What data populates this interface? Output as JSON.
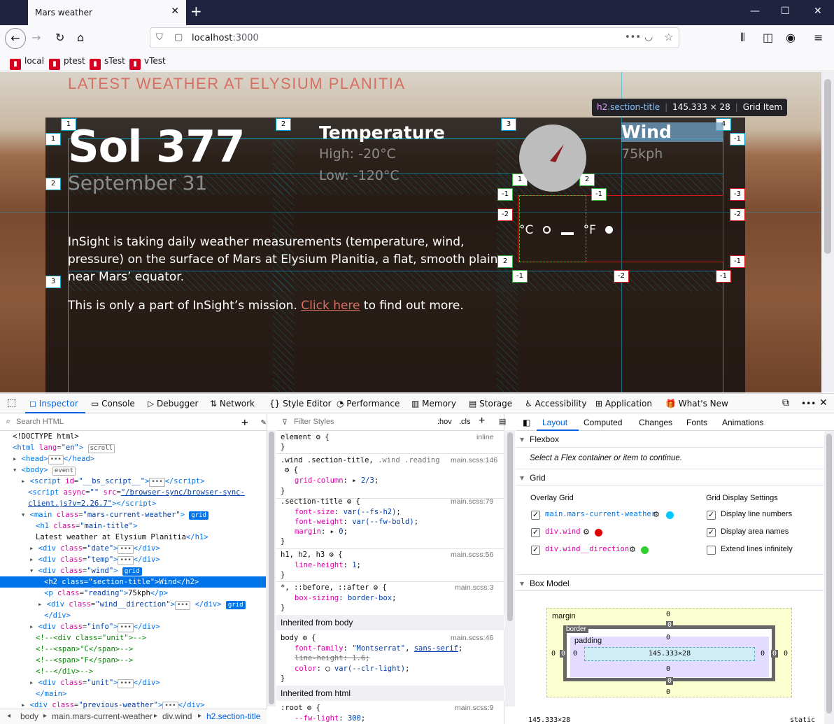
{
  "browser": {
    "tab_title": "Mars weather",
    "url_host": "localhost",
    "url_port": ":3000",
    "bookmarks": [
      "local",
      "ptest",
      "sTest",
      "vTest"
    ]
  },
  "page": {
    "main_title": "LATEST WEATHER AT ELYSIUM PLANITIA",
    "sol": "Sol 377",
    "date": "September 31",
    "temp_title": "Temperature",
    "high": "High: -20°C",
    "low": "Low: -120°C",
    "wind_title": "Wind",
    "wind_reading": "75kph",
    "unit_c": "°C",
    "unit_f": "°F",
    "info_text": "InSight is taking daily weather measurements (temperature, wind, pressure) on the surface of Mars at Elysium Planitia, a flat, smooth plain near Mars’ equator.",
    "info2_before": "This is only a part of InSight’s mission.",
    "info2_link": "Click here",
    "info2_after": "to find out more.",
    "tooltip_tag": "h2",
    "tooltip_class": ".section-title",
    "tooltip_size": "145.333 × 28",
    "tooltip_type": "Grid Item"
  },
  "grid_badges": {
    "top": [
      "1",
      "2",
      "3",
      "4"
    ],
    "left": [
      "1",
      "2",
      "3"
    ],
    "right": [
      "-1"
    ],
    "inner": [
      "1",
      "2",
      "-1",
      "-2",
      "-3",
      "-2",
      "-1",
      "2",
      "-1",
      "-2",
      "-1"
    ]
  },
  "devtools": {
    "tabs": [
      "Inspector",
      "Console",
      "Debugger",
      "Network",
      "Style Editor",
      "Performance",
      "Memory",
      "Storage",
      "Accessibility",
      "Application",
      "What's New"
    ],
    "search_placeholder": "Search HTML",
    "filter_placeholder": "Filter Styles",
    "hov": ":hov",
    "cls": ".cls",
    "layout_tabs": [
      "Layout",
      "Computed",
      "Changes",
      "Fonts",
      "Animations"
    ],
    "flexbox_title": "Flexbox",
    "flexbox_msg": "Select a Flex container or item to continue.",
    "grid_title": "Grid",
    "overlay_grid": "Overlay Grid",
    "grid_items": [
      "main.mars-current-weather",
      "div.wind",
      "div.wind__direction"
    ],
    "grid_colors": [
      "#00c8ff",
      "#e00000",
      "#30d030"
    ],
    "display_settings_title": "Grid Display Settings",
    "display_settings": [
      "Display line numbers",
      "Display area names",
      "Extend lines infinitely"
    ],
    "display_checked": [
      true,
      true,
      false
    ],
    "boxmodel_title": "Box Model",
    "bm_margin": "margin",
    "bm_border": "border",
    "bm_padding": "padding",
    "bm_content": "145.333×28",
    "bm_zero": "0",
    "bm_footer_size": "145.333×28",
    "bm_footer_pos": "static",
    "breadcrumbs": [
      "body",
      "main.mars-current-weather",
      "div.wind",
      "h2.section-title"
    ]
  }
}
